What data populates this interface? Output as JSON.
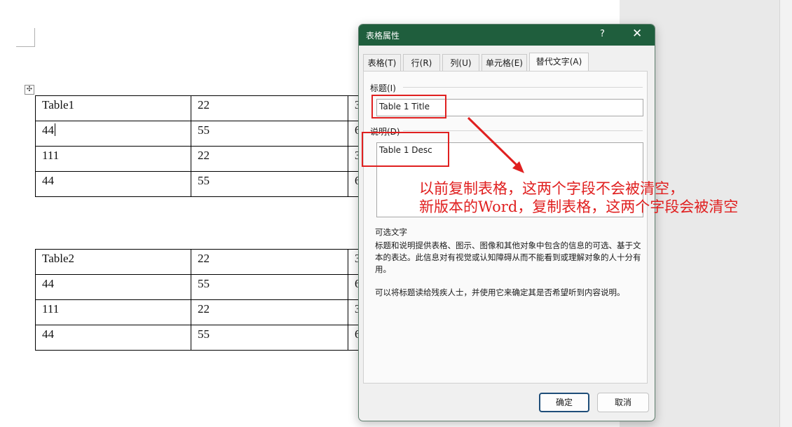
{
  "doc": {
    "table1": [
      [
        "Table1",
        "22",
        "3"
      ],
      [
        "44",
        "55",
        "6"
      ],
      [
        "111",
        "22",
        "3"
      ],
      [
        "44",
        "55",
        "6"
      ]
    ],
    "table2": [
      [
        "Table2",
        "22",
        "3"
      ],
      [
        "44",
        "55",
        "6"
      ],
      [
        "111",
        "22",
        "3"
      ],
      [
        "44",
        "55",
        "6"
      ]
    ]
  },
  "dialog": {
    "title": "表格属性",
    "help": "?",
    "close": "✕",
    "tabs": [
      "表格(T)",
      "行(R)",
      "列(U)",
      "单元格(E)",
      "替代文字(A)"
    ],
    "active_tab_index": 4,
    "title_label": "标题(I)",
    "title_value": "Table 1 Title",
    "desc_label": "说明(D)",
    "desc_value": "Table 1 Desc",
    "alt_header": "可选文字",
    "alt_text_1": "标题和说明提供表格、图示、图像和其他对象中包含的信息的可选、基于文本的表达。此信息对有视觉或认知障碍从而不能看到或理解对象的人十分有用。",
    "alt_text_2": "可以将标题读给残疾人士，并使用它来确定其是否希望听到内容说明。",
    "ok_label": "确定",
    "cancel_label": "取消"
  },
  "annotation": {
    "line1": "以前复制表格，这两个字段不会被清空，",
    "line2": "新版本的Word，复制表格，这两个字段会被清空"
  },
  "colors": {
    "titlebar": "#1f5e3d",
    "annotation": "#e02020"
  }
}
